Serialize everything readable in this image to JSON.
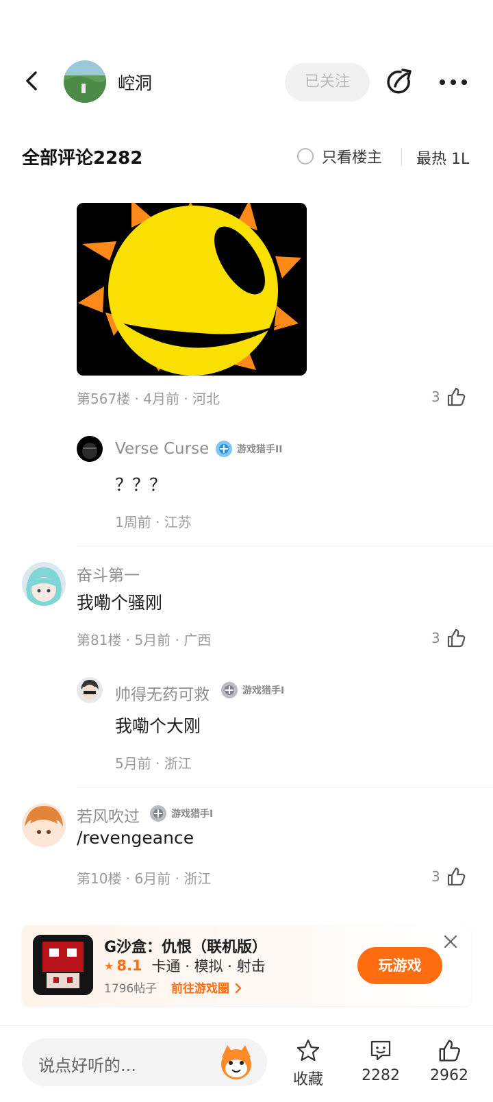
{
  "header": {
    "author_name": "崆洞",
    "follow_label": "已关注"
  },
  "comments_header": {
    "title": "全部评论2282",
    "only_op_label": "只看楼主",
    "sort_label": "最热 1L"
  },
  "comments": [
    {
      "floor_meta": "第567楼 · 4月前 · 河北",
      "likes": "3",
      "reply": {
        "user": "Verse Curse",
        "badge": "游戏猎手II",
        "text": "？？？",
        "meta": "1周前 · 江苏"
      }
    },
    {
      "user": "奋斗第一",
      "text": "我嘞个骚刚",
      "floor_meta": "第81楼 · 5月前 · 广西",
      "likes": "3",
      "reply": {
        "user": "帅得无药可救",
        "badge": "游戏猎手I",
        "text": "我嘞个大刚",
        "meta": "5月前 · 浙江"
      }
    },
    {
      "user": "若风吹过",
      "badge": "游戏猎手I",
      "text": "/revengeance",
      "floor_meta": "第10楼 · 6月前 · 浙江",
      "likes": "3"
    }
  ],
  "game_card": {
    "title": "G沙盒：仇恨（联机版）",
    "score": "8.1",
    "tags": "卡通 · 模拟 · 射击",
    "posts": "1796帖子",
    "goto_label": "前往游戏圈",
    "play_label": "玩游戏",
    "accent_color": "#ff6d10"
  },
  "bottom_bar": {
    "input_placeholder": "说点好听的...",
    "favorite_label": "收藏",
    "comment_count": "2282",
    "like_count": "2962"
  }
}
